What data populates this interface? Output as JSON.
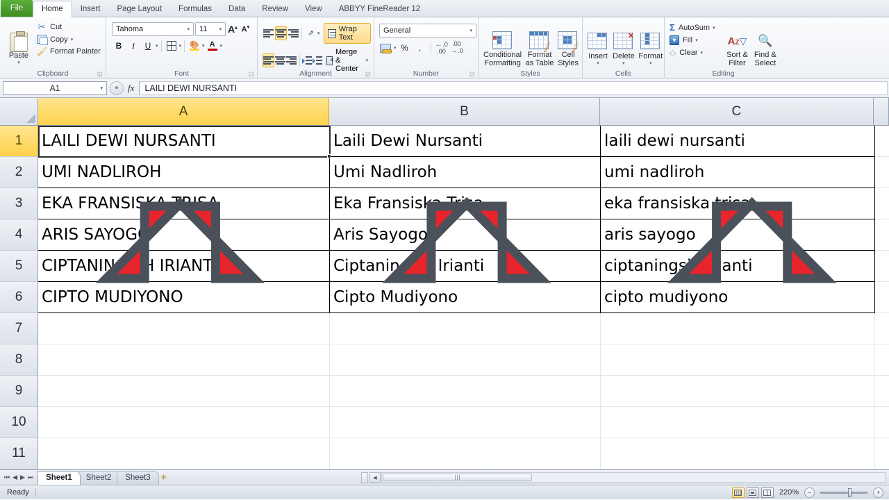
{
  "tabs": [
    {
      "label": "File",
      "kind": "file"
    },
    {
      "label": "Home",
      "kind": "active"
    },
    {
      "label": "Insert",
      "kind": "normal"
    },
    {
      "label": "Page Layout",
      "kind": "normal"
    },
    {
      "label": "Formulas",
      "kind": "normal"
    },
    {
      "label": "Data",
      "kind": "normal"
    },
    {
      "label": "Review",
      "kind": "normal"
    },
    {
      "label": "View",
      "kind": "normal"
    },
    {
      "label": "ABBYY FineReader 12",
      "kind": "normal"
    }
  ],
  "ribbon": {
    "clipboard": {
      "group_label": "Clipboard",
      "paste": "Paste",
      "cut": "Cut",
      "copy": "Copy",
      "format_painter": "Format Painter"
    },
    "font": {
      "group_label": "Font",
      "font_name": "Tahoma",
      "font_size": "11",
      "bold": "B",
      "italic": "I",
      "underline": "U"
    },
    "alignment": {
      "group_label": "Alignment",
      "wrap_text": "Wrap Text",
      "merge_center": "Merge & Center"
    },
    "number": {
      "group_label": "Number",
      "format": "General",
      "percent": "%",
      "comma": ","
    },
    "styles": {
      "group_label": "Styles",
      "conditional_formatting": "Conditional\nFormatting",
      "conditional_formatting_l1": "Conditional",
      "conditional_formatting_l2": "Formatting",
      "format_as_table_l1": "Format",
      "format_as_table_l2": "as Table",
      "cell_styles_l1": "Cell",
      "cell_styles_l2": "Styles"
    },
    "cells": {
      "group_label": "Cells",
      "insert": "Insert",
      "delete": "Delete",
      "format": "Format"
    },
    "editing": {
      "group_label": "Editing",
      "autosum": "AutoSum",
      "fill": "Fill",
      "clear": "Clear",
      "sort_filter_l1": "Sort &",
      "sort_filter_l2": "Filter",
      "find_select_l1": "Find &",
      "find_select_l2": "Select"
    }
  },
  "formula_bar": {
    "name_box": "A1",
    "fx_label": "fx",
    "value": "LAILI DEWI NURSANTI"
  },
  "grid": {
    "column_headers": [
      "A",
      "B",
      "C"
    ],
    "selected_column": "A",
    "selected_row": "1",
    "row_headers": [
      "1",
      "2",
      "3",
      "4",
      "5",
      "6",
      "7",
      "8",
      "9",
      "10",
      "11"
    ],
    "rows": [
      {
        "A": "LAILI DEWI NURSANTI",
        "B": "Laili Dewi Nursanti",
        "C": "laili dewi nursanti"
      },
      {
        "A": "UMI NADLIROH",
        "B": "Umi Nadliroh",
        "C": "umi nadliroh"
      },
      {
        "A": "EKA FRANSISKA TRISA",
        "B": "Eka Fransiska Trisa",
        "C": "eka fransiska trisa"
      },
      {
        "A": "ARIS SAYOGO",
        "B": "Aris Sayogo",
        "C": "aris sayogo"
      },
      {
        "A": "CIPTANINGSIH IRIANTI",
        "B": "Ciptaningsih Irianti",
        "C": "ciptaningsih irianti"
      },
      {
        "A": "CIPTO MUDIYONO",
        "B": "Cipto Mudiyono",
        "C": "cipto mudiyono"
      }
    ],
    "annotations": {
      "type": "up-arrow",
      "count": 3,
      "fill_color": "#E8242C",
      "outline_color": "#4A515A",
      "points_to_columns": [
        "A",
        "B",
        "C"
      ]
    }
  },
  "sheet_bar": {
    "tabs": [
      "Sheet1",
      "Sheet2",
      "Sheet3"
    ],
    "active": "Sheet1"
  },
  "status_bar": {
    "state": "Ready",
    "zoom": "220%"
  }
}
